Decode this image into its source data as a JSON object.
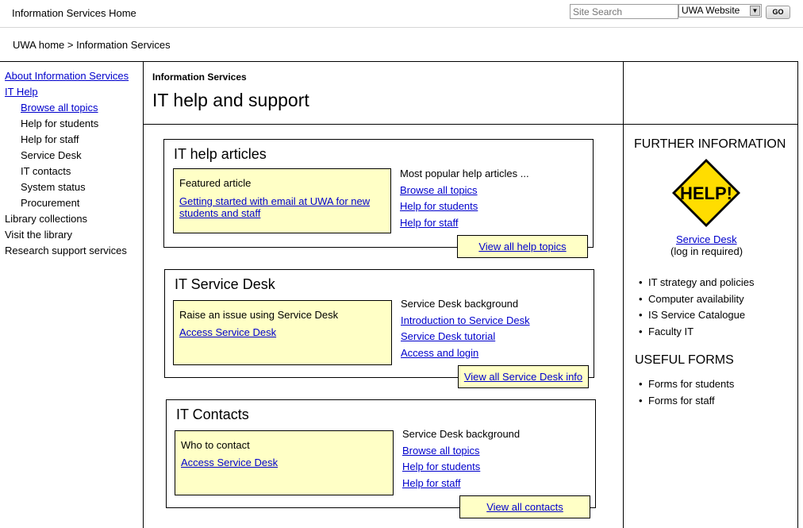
{
  "topbar": {
    "site_title": "Information Services Home",
    "search_placeholder": "Site Search",
    "scope_select_value": "UWA Website",
    "go_label": "GO"
  },
  "breadcrumb": "UWA home > Information Services",
  "left_nav": [
    {
      "label": "About Information Services",
      "link": true,
      "level": 0
    },
    {
      "label": "IT Help",
      "link": true,
      "level": 0
    },
    {
      "label": "Browse all topics",
      "link": true,
      "level": 1
    },
    {
      "label": "Help for students",
      "link": false,
      "level": 1
    },
    {
      "label": "Help for staff",
      "link": false,
      "level": 1
    },
    {
      "label": "Service Desk",
      "link": false,
      "level": 1
    },
    {
      "label": "IT contacts",
      "link": false,
      "level": 1
    },
    {
      "label": "System status",
      "link": false,
      "level": 1
    },
    {
      "label": "Procurement",
      "link": false,
      "level": 1
    },
    {
      "label": "Library collections",
      "link": false,
      "level": 0
    },
    {
      "label": "Visit the library",
      "link": false,
      "level": 0
    },
    {
      "label": "Research support services",
      "link": false,
      "level": 0
    }
  ],
  "header": {
    "section_label": "Information Services",
    "page_title": "IT help and support"
  },
  "cards": [
    {
      "title": "IT help articles",
      "featured_label": "Featured article",
      "featured_link": "Getting started with email at UWA for new students and staff",
      "right_heading": "Most popular help articles ...",
      "right_links": [
        "Browse all topics",
        "Help for students",
        "Help for staff"
      ],
      "view_all": "View all help topics"
    },
    {
      "title": "IT Service Desk",
      "featured_label": "Raise an issue using Service Desk",
      "featured_link": "Access Service Desk",
      "right_heading": "Service Desk background",
      "right_links": [
        "Introduction to Service Desk",
        "Service Desk tutorial",
        "Access and login"
      ],
      "view_all": "View all Service Desk info"
    },
    {
      "title": "IT Contacts",
      "featured_label": "Who to contact",
      "featured_link": "Access Service Desk",
      "right_heading": "Service Desk background",
      "right_links": [
        "Browse all topics",
        "Help for students",
        "Help for staff"
      ],
      "view_all": "View all contacts"
    }
  ],
  "sidebar": {
    "further_heading": "FURTHER INFORMATION",
    "help_sign_text": "HELP!",
    "help_sign_color": "#ffdd00",
    "service_desk_link": "Service Desk",
    "service_desk_note": "(log in required)",
    "further_items": [
      "IT strategy and policies",
      "Computer availability",
      "IS Service Catalogue",
      "Faculty IT"
    ],
    "forms_heading": "USEFUL FORMS",
    "forms_items": [
      "Forms for students",
      "Forms for staff"
    ]
  }
}
